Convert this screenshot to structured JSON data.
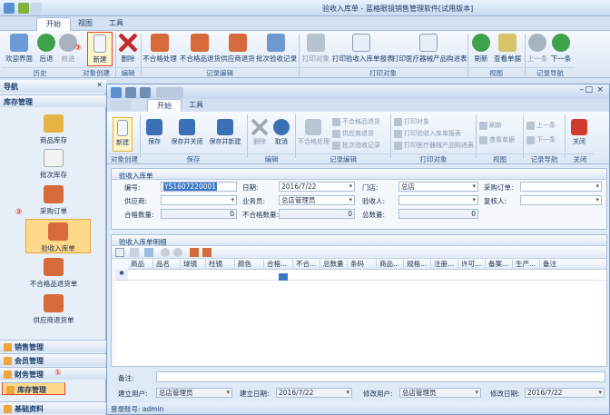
{
  "outer": {
    "title": "验收入库单 - 蓝格眼镜销售管理软件[试用版本]",
    "tabs": [
      "开始",
      "视图",
      "工具"
    ],
    "ribbon": {
      "buttons": [
        "欢迎界面",
        "后退",
        "前进",
        "新建",
        "删除",
        "不合格处理",
        "不合格品退货",
        "供应商退货",
        "批次验收记录",
        "打印对象",
        "打印验收入库单报表",
        "打印医疗器械产品购进表",
        "刷新",
        "查看单据",
        "上一条",
        "下一条"
      ],
      "groups": [
        "历史",
        "对象创建",
        "编辑",
        "记录编辑",
        "打印对象",
        "视图",
        "记录导航"
      ]
    },
    "annotations": {
      "a3": "③",
      "a2": "②",
      "a1": "①"
    }
  },
  "nav": {
    "header": "导航",
    "top_section": "库存管理",
    "items": [
      "商品库存",
      "批次库存",
      "采购订单",
      "验收入库单",
      "不合格品退货单",
      "供应商退货单"
    ],
    "sections": [
      "销售管理",
      "会员管理",
      "财务管理",
      "库存管理",
      "基础资料"
    ]
  },
  "win": {
    "tabs": [
      "开始",
      "工具"
    ],
    "ribbon": {
      "new": "新建",
      "save": "保存",
      "save_close": "保存并关闭",
      "save_new": "保存并新建",
      "delete": "删除",
      "cancel": "取消",
      "unqualified": "不合格处理",
      "lines": [
        "不合格品退货",
        "供应商退货",
        "批次验收记录"
      ],
      "print_lines": [
        "打印对象",
        "打印验收入库单报表",
        "打印医疗器械产品购进表"
      ],
      "refresh": "刷新",
      "view_doc": "查看单据",
      "prev": "上一条",
      "next": "下一条",
      "close": "关闭",
      "groups": [
        "对象创建",
        "保存",
        "编辑",
        "记录编辑",
        "打印对象",
        "视图",
        "记录导航",
        "关闭"
      ]
    },
    "form": {
      "panel": "验收入库单",
      "no_label": "编号:",
      "no_value": "YS1607220001",
      "date_label": "日期:",
      "date_value": "2016/7/22",
      "store_label": "门店:",
      "store_value": "总店",
      "po_label": "采购订单:",
      "supplier_label": "供应商:",
      "clerk_label": "业务员:",
      "clerk_value": "总店管理员",
      "inspector_label": "验收人:",
      "reviewer_label": "复核人:",
      "qualified_label": "合格数量:",
      "qualified_value": "0",
      "unqualified_label": "不合格数量:",
      "unqualified_value": "0",
      "total_label": "总数量:",
      "total_value": "0"
    },
    "grid": {
      "panel": "验收入库单明细",
      "columns": [
        "商品",
        "品名",
        "球镜",
        "柱镜",
        "颜色",
        "合格...",
        "不合...",
        "总数量",
        "条码",
        "商品...",
        "规格...",
        "注册...",
        "许可...",
        "备案...",
        "生产...",
        "备注"
      ]
    },
    "bottom": {
      "note_label": "备注:",
      "creator_label": "建立用户:",
      "creator_value": "总店管理员",
      "created_label": "建立日期:",
      "created_value": "2016/7/22",
      "modifier_label": "修改用户:",
      "modifier_value": "总店管理员",
      "modified_label": "修改日期:",
      "modified_value": "2016/7/22"
    },
    "status": "登录账号: admin"
  }
}
